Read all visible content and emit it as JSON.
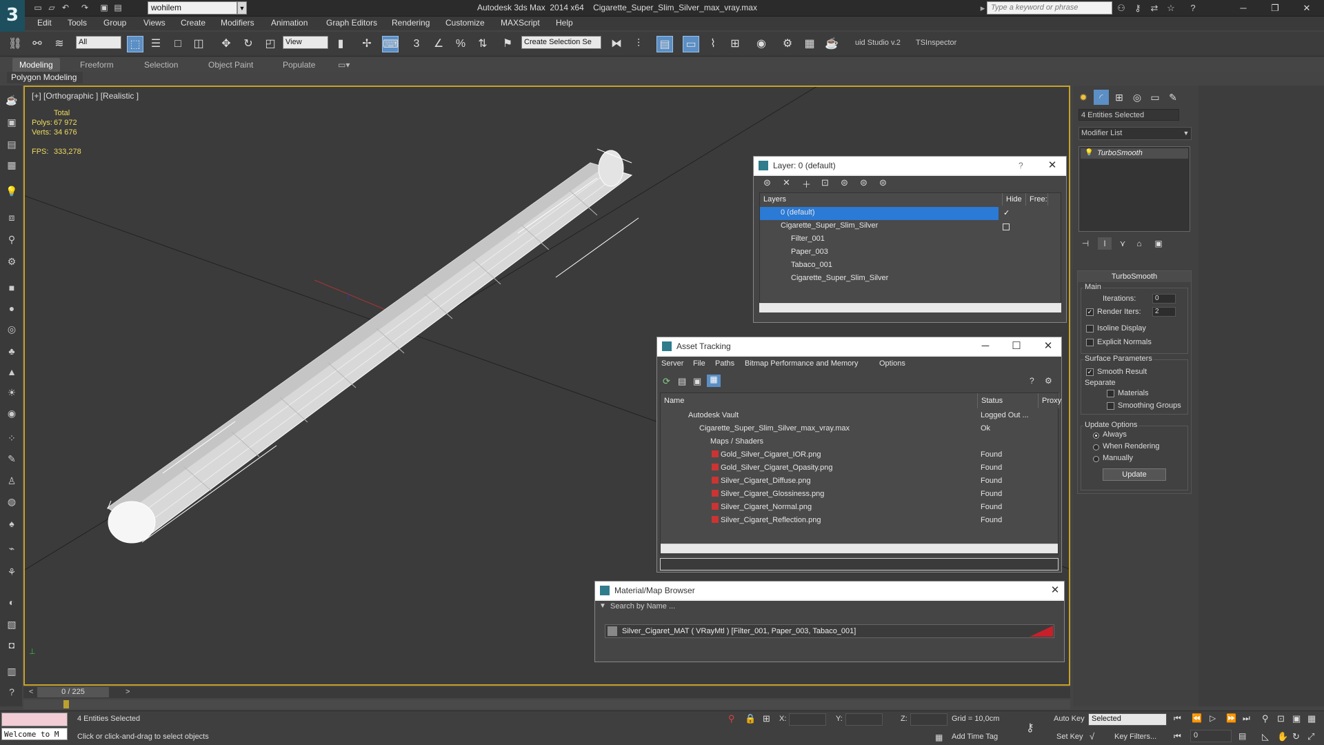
{
  "app": {
    "title": "Autodesk 3ds Max  2014 x64    Cigarette_Super_Slim_Silver_max_vray.max",
    "logo": "3",
    "workspace": "wohilem",
    "search_placeholder": "Type a keyword or phrase"
  },
  "menu": [
    "Edit",
    "Tools",
    "Group",
    "Views",
    "Create",
    "Modifiers",
    "Animation",
    "Graph Editors",
    "Rendering",
    "Customize",
    "MAXScript",
    "Help"
  ],
  "toolbar": {
    "filter": "All",
    "refcoord": "View",
    "selection_set": "Create Selection Se",
    "plugin1": "uid Studio v.2",
    "plugin2": "TSInspector"
  },
  "ribbon": {
    "tabs": [
      "Modeling",
      "Freeform",
      "Selection",
      "Object Paint",
      "Populate"
    ],
    "panel": "Polygon Modeling"
  },
  "viewport": {
    "label": "[+] [Orthographic ] [Realistic ]",
    "stats_header": "Total",
    "polys_label": "Polys:",
    "polys": "67 972",
    "verts_label": "Verts:",
    "verts": "34 676",
    "fps_label": "FPS:",
    "fps": "333,278"
  },
  "layer_window": {
    "title": "Layer: 0 (default)",
    "help": "?",
    "col_layers": "Layers",
    "col_hide": "Hide",
    "col_freeze": "Free:",
    "rows": [
      "0 (default)",
      "Cigarette_Super_Slim_Silver",
      "Filter_001",
      "Paper_003",
      "Tabaco_001",
      "Cigarette_Super_Slim_Silver"
    ]
  },
  "asset_window": {
    "title": "Asset Tracking",
    "menu": [
      "Server",
      "File",
      "Paths",
      "Bitmap Performance and Memory",
      "Options"
    ],
    "col_name": "Name",
    "col_status": "Status",
    "col_proxy": "Proxy",
    "rows": [
      {
        "name": "Autodesk Vault",
        "status": "Logged Out ..."
      },
      {
        "name": "Cigarette_Super_Slim_Silver_max_vray.max",
        "status": "Ok"
      },
      {
        "name": "Maps / Shaders",
        "status": ""
      },
      {
        "name": "Gold_Silver_Cigaret_IOR.png",
        "status": "Found"
      },
      {
        "name": "Gold_Silver_Cigaret_Opasity.png",
        "status": "Found"
      },
      {
        "name": "Silver_Cigaret_Diffuse.png",
        "status": "Found"
      },
      {
        "name": "Silver_Cigaret_Glossiness.png",
        "status": "Found"
      },
      {
        "name": "Silver_Cigaret_Normal.png",
        "status": "Found"
      },
      {
        "name": "Silver_Cigaret_Reflection.png",
        "status": "Found"
      }
    ]
  },
  "material_browser": {
    "title": "Material/Map Browser",
    "search_placeholder": "Search by Name ...",
    "item": "Silver_Cigaret_MAT  ( VRayMtl )  [Filter_001, Paper_003, Tabaco_001]"
  },
  "command_panel": {
    "selection": "4 Entities Selected",
    "modifier_list": "Modifier List",
    "stack_item": "TurboSmooth",
    "rollout_title": "TurboSmooth",
    "main_group": "Main",
    "iterations_label": "Iterations:",
    "iterations": "0",
    "render_iters_label": "Render Iters:",
    "render_iters": "2",
    "isoline": "Isoline Display",
    "explicit_normals": "Explicit Normals",
    "surface_group": "Surface Parameters",
    "smooth_result": "Smooth Result",
    "separate_label": "Separate",
    "materials": "Materials",
    "smoothing_groups": "Smoothing Groups",
    "update_group": "Update Options",
    "always": "Always",
    "when_rendering": "When Rendering",
    "manually": "Manually",
    "update_btn": "Update"
  },
  "timeline": {
    "frame": "0 / 225"
  },
  "status": {
    "maxscript": "Welcome to M",
    "selected": "4 Entities Selected",
    "prompt": "Click or click-and-drag to select objects",
    "x_label": "X:",
    "y_label": "Y:",
    "z_label": "Z:",
    "grid": "Grid = 10,0cm",
    "add_time_tag": "Add Time Tag",
    "auto_key": "Auto Key",
    "set_key": "Set Key",
    "key_mode": "Selected",
    "key_filters": "Key Filters...",
    "frame_field": "0"
  }
}
